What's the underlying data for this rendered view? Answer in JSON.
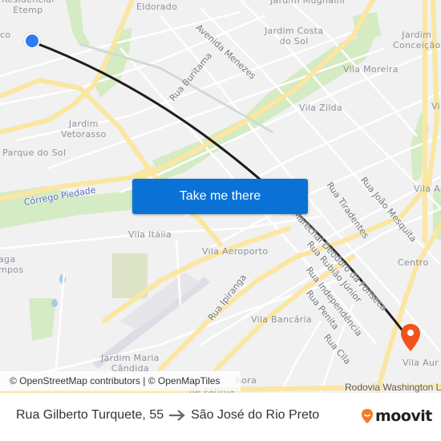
{
  "map": {
    "neighborhoods": [
      {
        "id": "residencial-etemp",
        "text": "Residencial\nEtemp"
      },
      {
        "id": "eldorado",
        "text": "Eldorado"
      },
      {
        "id": "jardim-mugnaini",
        "text": "Jardim Mugnaini"
      },
      {
        "id": "jardim-costa-do-sol",
        "text": "Jardim Costa\ndo Sol"
      },
      {
        "id": "jardim-conceicao",
        "text": "Jardim\nConceição"
      },
      {
        "id": "vila-moreira",
        "text": "Vila Moreira"
      },
      {
        "id": "vila-zilda",
        "text": "Vila Zilda"
      },
      {
        "id": "jardim-vetorasso",
        "text": "Jardim\nVetorasso"
      },
      {
        "id": "parque-do-sol",
        "text": "Parque do Sol"
      },
      {
        "id": "vila-italia",
        "text": "Vila Itália"
      },
      {
        "id": "vila-aeroporto",
        "text": "Vila Aeroporto"
      },
      {
        "id": "centro",
        "text": "Centro"
      },
      {
        "id": "vila-bancaria",
        "text": "Vila Bancária"
      },
      {
        "id": "jardim-maria-candida",
        "text": "Jardim Maria\nCândida"
      },
      {
        "id": "vila-aurora",
        "text": "Vila Aur"
      },
      {
        "id": "co-fragment",
        "text": "co"
      },
      {
        "id": "aga-fragment",
        "text": "aga\nmpos"
      },
      {
        "id": "vila-a-fragment",
        "text": "Vila A"
      },
      {
        "id": "v-fragment",
        "text": "Vi"
      },
      {
        "id": "nossa-senhora-fragment",
        "text": "hora"
      },
      {
        "id": "fatima-fragment",
        "text": "de Fátima"
      }
    ],
    "streets": [
      {
        "id": "avenida-menezes",
        "text": "Avenida Menezes"
      },
      {
        "id": "rua-buritama",
        "text": "Rua Buritama"
      },
      {
        "id": "rua-tiradentes",
        "text": "Rua Tiradentes"
      },
      {
        "id": "rua-joao-mesquita",
        "text": "Rua João Mesquita"
      },
      {
        "id": "marechal-deodoro",
        "text": "Marechal Deodoro da Fonseca"
      },
      {
        "id": "rua-rubiao-junior",
        "text": "Rua Rubião Júnior"
      },
      {
        "id": "rua-independencia",
        "text": "Rua Independência"
      },
      {
        "id": "rua-penita",
        "text": "Rua Penita"
      },
      {
        "id": "rua-cila",
        "text": "Rua Cila"
      },
      {
        "id": "rua-ipiranga",
        "text": "Rua Ipiranga"
      },
      {
        "id": "corrego-piedade",
        "text": "Córrego Piedade"
      },
      {
        "id": "rodovia-washington",
        "text": "Rodovia Washington L"
      }
    ],
    "attribution": "© OpenStreetMap contributors | © OpenMapTiles",
    "colors": {
      "background": "#f1f1f1",
      "major_road": "#fbe6a2",
      "minor_road": "#ffffff",
      "park": "#d4ebc4",
      "route": "#1e1e1e",
      "origin": "#2f7bf2",
      "destination": "#f0531c"
    }
  },
  "cta": {
    "label": "Take me there",
    "color": "#0a72d6"
  },
  "footer": {
    "origin": "Rua Gilberto Turquete, 55",
    "destination": "São José do Rio Preto",
    "arrow_icon": "arrow-right-icon",
    "brand": "moovit",
    "brand_color": "#f47b20"
  }
}
